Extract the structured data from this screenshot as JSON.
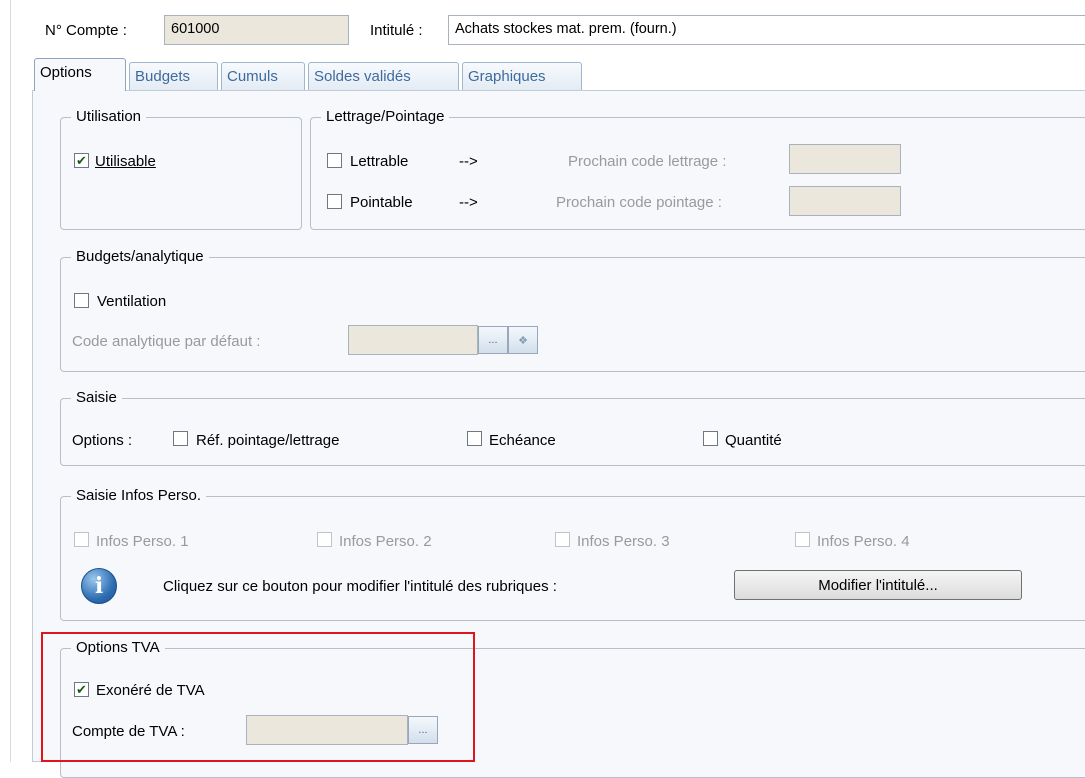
{
  "header": {
    "account_label": "N° Compte :",
    "account_value": "601000",
    "title_label": "Intitulé :",
    "title_value": "Achats stockes mat. prem. (fourn.)"
  },
  "tabs": [
    {
      "label": "Options",
      "active": true
    },
    {
      "label": "Budgets",
      "active": false
    },
    {
      "label": "Cumuls",
      "active": false
    },
    {
      "label": "Soldes validés",
      "active": false
    },
    {
      "label": "Graphiques",
      "active": false
    }
  ],
  "utilisation": {
    "title": "Utilisation",
    "utilisable_label": "Utilisable",
    "utilisable_checked": true
  },
  "lettrage": {
    "title": "Lettrage/Pointage",
    "lettrable_label": "Lettrable",
    "lettrable_checked": false,
    "pointable_label": "Pointable",
    "pointable_checked": false,
    "arrow": "-->",
    "next_lettrage_label": "Prochain code lettrage :",
    "next_pointage_label": "Prochain code pointage :"
  },
  "budgets": {
    "title": "Budgets/analytique",
    "ventilation_label": "Ventilation",
    "ventilation_checked": false,
    "default_code_label": "Code analytique par défaut :",
    "browse_label": "..."
  },
  "saisie": {
    "title": "Saisie",
    "options_label": "Options :",
    "ref_label": "Réf. pointage/lettrage",
    "ref_checked": false,
    "echeance_label": "Echéance",
    "echeance_checked": false,
    "quantite_label": "Quantité",
    "quantite_checked": false
  },
  "infos_perso": {
    "title": "Saisie Infos Perso.",
    "items": [
      "Infos Perso. 1",
      "Infos Perso. 2",
      "Infos Perso. 3",
      "Infos Perso. 4"
    ],
    "info_text": "Cliquez sur ce bouton pour modifier l'intitulé des rubriques :",
    "modify_button": "Modifier l'intitulé...",
    "info_icon": "info-icon"
  },
  "tva": {
    "title": "Options TVA",
    "exonere_label": "Exonéré de TVA",
    "exonere_checked": true,
    "compte_label": "Compte de TVA :",
    "browse_label": "..."
  },
  "colors": {
    "highlight": "#e0141b",
    "disabled_field": "#ece7dc",
    "tab_text": "#3d6b9d"
  }
}
